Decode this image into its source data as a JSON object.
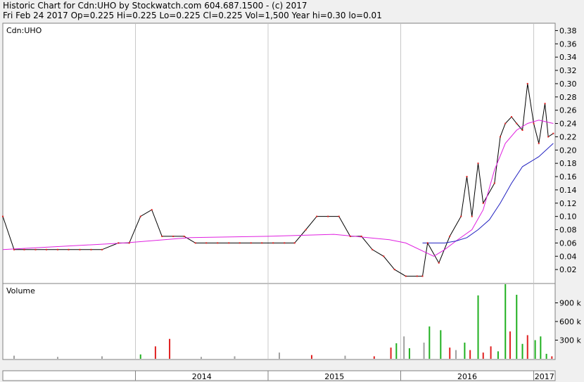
{
  "header": {
    "title": "Historic Chart for Cdn:UHO by Stockwatch.com 604.687.1500 - (c) 2017",
    "quote": "Fri Feb 24 2017   Op=0.225  Hi=0.225  Lo=0.225  Cl=0.225  Vol=1,500  Year hi=0.30  lo=0.01"
  },
  "colors": {
    "price": "#000000",
    "ma_short": "#e020e0",
    "ma_long": "#2020c0",
    "vol_up": "#20b020",
    "vol_down": "#e02020",
    "vol_flat": "#a0a0a0"
  },
  "chart_data": [
    {
      "type": "line",
      "label": "Cdn:UHO",
      "y_ticks": [
        "0.38",
        "0.36",
        "0.34",
        "0.32",
        "0.30",
        "0.28",
        "0.26",
        "0.24",
        "0.22",
        "0.20",
        "0.18",
        "0.16",
        "0.14",
        "0.12",
        "0.10",
        "0.08",
        "0.06",
        "0.04",
        "0.02"
      ],
      "ylim": [
        0.0,
        0.39
      ],
      "x_ticks": [
        "2014",
        "2015",
        "2016",
        "2017"
      ],
      "grid": true,
      "series": [
        {
          "points": [
            [
              "2013-01-01",
              0.1
            ],
            [
              "2013-02-01",
              0.05
            ],
            [
              "2013-03-01",
              0.05
            ],
            [
              "2013-04-01",
              0.05
            ],
            [
              "2013-05-01",
              0.05
            ],
            [
              "2013-06-01",
              0.05
            ],
            [
              "2013-07-01",
              0.05
            ],
            [
              "2013-08-01",
              0.05
            ],
            [
              "2013-09-01",
              0.05
            ],
            [
              "2013-10-01",
              0.05
            ],
            [
              "2013-11-15",
              0.06
            ],
            [
              "2013-12-15",
              0.06
            ],
            [
              "2014-01-15",
              0.1
            ],
            [
              "2014-02-15",
              0.11
            ],
            [
              "2014-03-15",
              0.07
            ],
            [
              "2014-04-15",
              0.07
            ],
            [
              "2014-05-15",
              0.07
            ],
            [
              "2014-06-15",
              0.06
            ],
            [
              "2014-07-15",
              0.06
            ],
            [
              "2014-08-15",
              0.06
            ],
            [
              "2014-09-15",
              0.06
            ],
            [
              "2014-10-15",
              0.06
            ],
            [
              "2014-11-15",
              0.06
            ],
            [
              "2014-12-15",
              0.06
            ],
            [
              "2015-01-15",
              0.06
            ],
            [
              "2015-02-15",
              0.06
            ],
            [
              "2015-03-15",
              0.06
            ],
            [
              "2015-04-15",
              0.08
            ],
            [
              "2015-05-15",
              0.1
            ],
            [
              "2015-06-15",
              0.1
            ],
            [
              "2015-07-15",
              0.1
            ],
            [
              "2015-08-15",
              0.07
            ],
            [
              "2015-09-15",
              0.07
            ],
            [
              "2015-10-15",
              0.05
            ],
            [
              "2015-11-15",
              0.04
            ],
            [
              "2015-12-15",
              0.02
            ],
            [
              "2016-01-15",
              0.01
            ],
            [
              "2016-02-15",
              0.01
            ],
            [
              "2016-03-01",
              0.01
            ],
            [
              "2016-03-15",
              0.06
            ],
            [
              "2016-04-15",
              0.03
            ],
            [
              "2016-05-15",
              0.07
            ],
            [
              "2016-06-15",
              0.1
            ],
            [
              "2016-07-01",
              0.16
            ],
            [
              "2016-07-15",
              0.1
            ],
            [
              "2016-08-01",
              0.18
            ],
            [
              "2016-08-15",
              0.12
            ],
            [
              "2016-09-15",
              0.15
            ],
            [
              "2016-10-01",
              0.22
            ],
            [
              "2016-10-15",
              0.24
            ],
            [
              "2016-11-01",
              0.25
            ],
            [
              "2016-11-15",
              0.24
            ],
            [
              "2016-12-01",
              0.23
            ],
            [
              "2016-12-15",
              0.3
            ],
            [
              "2017-01-01",
              0.24
            ],
            [
              "2017-01-15",
              0.21
            ],
            [
              "2017-02-01",
              0.27
            ],
            [
              "2017-02-10",
              0.22
            ],
            [
              "2017-02-24",
              0.225
            ]
          ]
        },
        {
          "points": [
            [
              "2013-01-01",
              0.05
            ],
            [
              "2013-12-01",
              0.06
            ],
            [
              "2014-06-01",
              0.068
            ],
            [
              "2015-01-01",
              0.07
            ],
            [
              "2015-07-01",
              0.073
            ],
            [
              "2015-12-01",
              0.065
            ],
            [
              "2016-01-15",
              0.06
            ],
            [
              "2016-04-01",
              0.04
            ],
            [
              "2016-05-01",
              0.05
            ],
            [
              "2016-06-01",
              0.063
            ],
            [
              "2016-07-15",
              0.08
            ],
            [
              "2016-08-15",
              0.11
            ],
            [
              "2016-09-15",
              0.17
            ],
            [
              "2016-10-15",
              0.21
            ],
            [
              "2016-11-15",
              0.23
            ],
            [
              "2016-12-15",
              0.24
            ],
            [
              "2017-01-15",
              0.245
            ],
            [
              "2017-02-24",
              0.24
            ]
          ]
        },
        {
          "points": [
            [
              "2016-03-01",
              0.06
            ],
            [
              "2016-05-01",
              0.06
            ],
            [
              "2016-06-01",
              0.063
            ],
            [
              "2016-07-01",
              0.068
            ],
            [
              "2016-08-01",
              0.08
            ],
            [
              "2016-09-01",
              0.095
            ],
            [
              "2016-10-01",
              0.12
            ],
            [
              "2016-11-01",
              0.15
            ],
            [
              "2016-12-01",
              0.175
            ],
            [
              "2017-01-15",
              0.19
            ],
            [
              "2017-02-24",
              0.21
            ]
          ]
        }
      ]
    },
    {
      "type": "bar",
      "label": "Volume",
      "y_ticks": [
        "900 k",
        "600 k",
        "300 k"
      ],
      "ylim": [
        0,
        1200
      ],
      "bars": [
        [
          "2013-02-01",
          50,
          "flat"
        ],
        [
          "2013-06-01",
          30,
          "flat"
        ],
        [
          "2013-10-01",
          40,
          "flat"
        ],
        [
          "2014-01-15",
          70,
          "up"
        ],
        [
          "2014-02-25",
          200,
          "down"
        ],
        [
          "2014-04-05",
          320,
          "down"
        ],
        [
          "2014-07-01",
          30,
          "flat"
        ],
        [
          "2014-10-01",
          40,
          "flat"
        ],
        [
          "2015-02-01",
          100,
          "flat"
        ],
        [
          "2015-05-01",
          60,
          "down"
        ],
        [
          "2015-08-01",
          50,
          "flat"
        ],
        [
          "2015-10-20",
          40,
          "down"
        ],
        [
          "2015-12-05",
          180,
          "down"
        ],
        [
          "2015-12-20",
          250,
          "up"
        ],
        [
          "2016-01-10",
          360,
          "flat"
        ],
        [
          "2016-01-25",
          170,
          "up"
        ],
        [
          "2016-03-05",
          260,
          "flat"
        ],
        [
          "2016-03-20",
          520,
          "up"
        ],
        [
          "2016-04-20",
          460,
          "up"
        ],
        [
          "2016-05-15",
          180,
          "down"
        ],
        [
          "2016-06-01",
          140,
          "flat"
        ],
        [
          "2016-06-25",
          260,
          "up"
        ],
        [
          "2016-07-10",
          140,
          "down"
        ],
        [
          "2016-08-01",
          1020,
          "up"
        ],
        [
          "2016-08-15",
          100,
          "down"
        ],
        [
          "2016-09-05",
          200,
          "down"
        ],
        [
          "2016-09-25",
          120,
          "up"
        ],
        [
          "2016-10-15",
          1200,
          "up"
        ],
        [
          "2016-10-28",
          440,
          "down"
        ],
        [
          "2016-11-15",
          1030,
          "up"
        ],
        [
          "2016-12-01",
          240,
          "up"
        ],
        [
          "2016-12-15",
          380,
          "down"
        ],
        [
          "2017-01-05",
          300,
          "up"
        ],
        [
          "2017-01-20",
          360,
          "up"
        ],
        [
          "2017-02-05",
          80,
          "up"
        ],
        [
          "2017-02-20",
          40,
          "down"
        ]
      ]
    }
  ]
}
